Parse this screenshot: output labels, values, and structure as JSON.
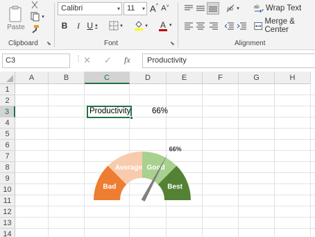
{
  "ribbon": {
    "clipboard": {
      "paste_label": "Paste",
      "group_label": "Clipboard"
    },
    "font": {
      "font_name": "Calibri",
      "font_size": "11",
      "bold": "B",
      "italic": "I",
      "underline": "U",
      "font_color_letter": "A",
      "grow_font": "A",
      "shrink_font": "A",
      "group_label": "Font",
      "highlight_color": "#ffff00",
      "text_color": "#c00000"
    },
    "alignment": {
      "wrap_text_label": "Wrap Text",
      "merge_center_label": "Merge & Center",
      "group_label": "Alignment"
    }
  },
  "formula_bar": {
    "name_box": "C3",
    "cancel_icon": "✕",
    "enter_icon": "✓",
    "fx": "fx",
    "formula": "Productivity"
  },
  "sheet": {
    "columns": [
      "A",
      "B",
      "C",
      "D",
      "E",
      "F",
      "G",
      "H"
    ],
    "selected_column": "C",
    "rows": [
      "1",
      "2",
      "3",
      "4",
      "5",
      "6",
      "7",
      "8",
      "9",
      "10",
      "11",
      "12",
      "13",
      "14"
    ],
    "selected_row": "3",
    "cells": {
      "C3": "Productivity",
      "D3": "66%"
    }
  },
  "gauge": {
    "value_label": "66%",
    "value": 0.66,
    "segments": [
      {
        "label": "Bad",
        "color": "#ed7d31",
        "share": 0.25
      },
      {
        "label": "Average",
        "color": "#f8cbad",
        "share": 0.25
      },
      {
        "label": "Good",
        "color": "#a9d18e",
        "share": 0.25
      },
      {
        "label": "Best",
        "color": "#548235",
        "share": 0.25
      }
    ],
    "needle_color": "#7f7f7f"
  }
}
